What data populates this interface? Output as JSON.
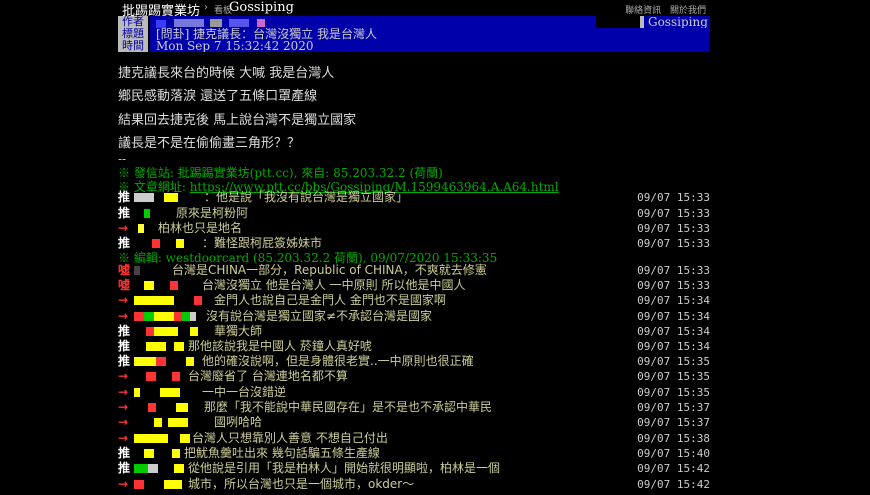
{
  "topbar": {
    "site": "批踢踢實業坊",
    "crumb_sep": "›",
    "crumb_label": "看板",
    "board": "Gossiping",
    "links": [
      "聯絡資訊",
      "關於我們"
    ]
  },
  "header": {
    "author_label": "作者",
    "title_label": "標題",
    "time_label": "時間",
    "board_label": "看板",
    "board_value": "Gossiping",
    "title": "[問卦] 捷克議長：台灣沒獨立  我是台灣人",
    "time": "Mon Sep  7 15:32:42 2020"
  },
  "content": [
    "捷克議長來台的時候   大喊   我是台灣人",
    "鄉民感動落淚   還送了五條口罩產線",
    "結果回去捷克後   馬上說台灣不是獨立國家",
    "議長是不是在偷偷畫三角形？？"
  ],
  "dashes": "--",
  "signature": {
    "from": "※ 發信站: 批踢踢實業坊(ptt.cc), 來自: 85.203.32.2 (荷蘭)",
    "url_label": "※ 文章網址:",
    "url": "https://www.ptt.cc/bbs/Gossiping/M.1599463964.A.A64.html"
  },
  "edit_line": "※ 編輯: westdoorcard (85.203.32.2 荷蘭), 09/07/2020 15:33:35",
  "pushes": [
    {
      "tag": "推",
      "text": "：他是說「我沒有說台灣是獨立國家」",
      "time": "09/07 15:33"
    },
    {
      "tag": "推",
      "text": "原來是柯粉阿",
      "time": "09/07 15:33"
    },
    {
      "tag": "→",
      "text": "柏林也只是地名",
      "time": "09/07 15:33"
    },
    {
      "tag": "推",
      "text": "：難怪跟柯屁簽姊妹市",
      "time": "09/07 15:33"
    },
    {
      "tag": "噓",
      "text": "台灣是CHINA一部分，Republic of CHINA，不爽就去修憲",
      "time": "09/07 15:33"
    },
    {
      "tag": "噓",
      "text": "台灣沒獨立  他是台灣人  一中原則  所以他是中國人",
      "time": "09/07 15:33"
    },
    {
      "tag": "→",
      "text": "金門人也說自己是金門人  金門也不是國家啊",
      "time": "09/07 15:34"
    },
    {
      "tag": "→",
      "text": "沒有說台灣是獨立國家≠不承認台灣是國家",
      "time": "09/07 15:34"
    },
    {
      "tag": "推",
      "text": "華獨大師",
      "time": "09/07 15:34"
    },
    {
      "tag": "推",
      "text": "那他該說我是中國人  菸鐘人真好唬",
      "time": "09/07 15:34"
    },
    {
      "tag": "推",
      "text": "他的確沒說啊，但是身體很老實..一中原則也很正確",
      "time": "09/07 15:35"
    },
    {
      "tag": "→",
      "text": "台灣廢省了  台灣連地名都不算",
      "time": "09/07 15:35"
    },
    {
      "tag": "→",
      "text": "一中一台沒錯逆",
      "time": "09/07 15:35"
    },
    {
      "tag": "→",
      "text": "那麼「我不能說中華民國存在」是不是也不承認中華民",
      "time": "09/07 15:37"
    },
    {
      "tag": "→",
      "text": "國咧哈哈",
      "time": "09/07 15:37"
    },
    {
      "tag": "→",
      "text": "台灣人只想靠別人善意  不想自己付出",
      "time": "09/07 15:38"
    },
    {
      "tag": "推",
      "text": "把魷魚羹吐出來  幾句話騙五條生產線",
      "time": "09/07 15:40"
    },
    {
      "tag": "推",
      "text": "從他說是引用「我是柏林人」開始就很明顯啦，柏林是一個",
      "time": "09/07 15:42"
    },
    {
      "tag": "→",
      "text": "城市，所以台灣也只是一個城市，okder～",
      "time": "09/07 15:42"
    }
  ],
  "colors": {
    "background": "#000000",
    "push_text": "#cccc99",
    "push_tag": "#ffffff",
    "boo_tag": "#ff3333",
    "arrow_tag": "#ff3333",
    "meta_bg": "#0000aa",
    "meta_label_bg": "#bbbbbb",
    "signature": "#00aa00"
  }
}
